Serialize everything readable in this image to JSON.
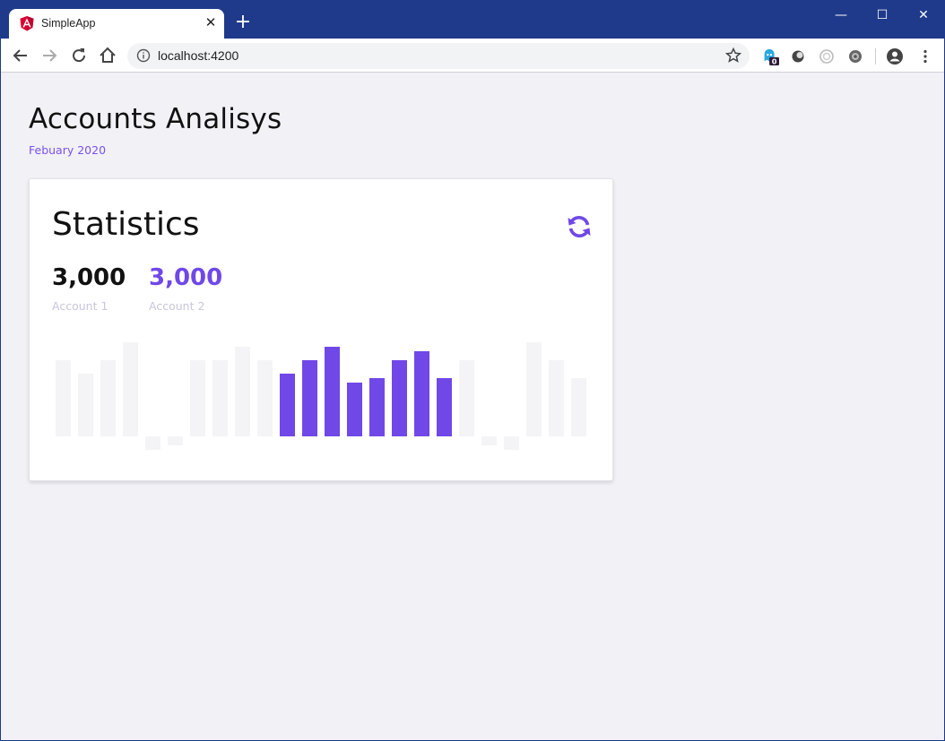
{
  "browser": {
    "tab_title": "SimpleApp",
    "tab_close": "✕",
    "new_tab": "+",
    "url": "localhost:4200",
    "controls": {
      "minimize": "—",
      "maximize": "☐",
      "close": "✕"
    },
    "extension_badge": "0"
  },
  "page": {
    "title": "Accounts Analisys",
    "subtitle": "Febuary 2020"
  },
  "card": {
    "title": "Statistics",
    "stats": [
      {
        "value": "3,000",
        "label": "Account 1",
        "color": "#111111"
      },
      {
        "value": "3,000",
        "label": "Account 2",
        "color": "#7048e8"
      }
    ]
  },
  "colors": {
    "accent": "#7048e8",
    "bar_muted": "#f4f4f7",
    "chrome_frame": "#1f3a8a"
  },
  "chart_data": {
    "type": "bar",
    "values": [
      17,
      14,
      17,
      21,
      -3,
      -2,
      17,
      17,
      20,
      17,
      14,
      17,
      20,
      12,
      13,
      17,
      19,
      13,
      17,
      -2,
      -3,
      21,
      17,
      13
    ],
    "highlighted": [
      false,
      false,
      false,
      false,
      false,
      false,
      false,
      false,
      false,
      false,
      true,
      true,
      true,
      true,
      true,
      true,
      true,
      true,
      false,
      false,
      false,
      false,
      false,
      false
    ]
  }
}
